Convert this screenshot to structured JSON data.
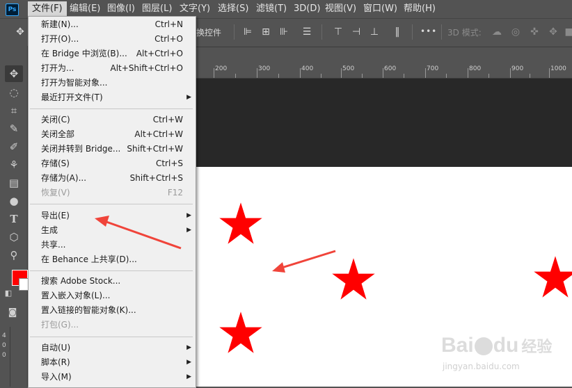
{
  "app": {
    "logo": "Ps"
  },
  "menubar": [
    {
      "label": "文件(F)",
      "active": true
    },
    {
      "label": "编辑(E)"
    },
    {
      "label": "图像(I)"
    },
    {
      "label": "图层(L)"
    },
    {
      "label": "文字(Y)"
    },
    {
      "label": "选择(S)"
    },
    {
      "label": "滤镜(T)"
    },
    {
      "label": "3D(D)"
    },
    {
      "label": "视图(V)"
    },
    {
      "label": "窗口(W)"
    },
    {
      "label": "帮助(H)"
    }
  ],
  "options": {
    "transform_label": "换控件",
    "mode_3d_label": "3D 模式:",
    "more": "•••"
  },
  "ruler": {
    "labels": [
      "200",
      "300",
      "400",
      "500",
      "600",
      "700",
      "800",
      "900",
      "1000"
    ],
    "left_labels": [
      "4",
      "0",
      "0"
    ]
  },
  "colors": {
    "foreground": "#ff0000",
    "background": "#ffffff",
    "star": "#ff0000",
    "arrow": "#f0443a"
  },
  "file_menu": {
    "items": [
      {
        "label": "新建(N)...",
        "shortcut": "Ctrl+N"
      },
      {
        "label": "打开(O)...",
        "shortcut": "Ctrl+O"
      },
      {
        "label": "在 Bridge 中浏览(B)...",
        "shortcut": "Alt+Ctrl+O"
      },
      {
        "label": "打开为...",
        "shortcut": "Alt+Shift+Ctrl+O"
      },
      {
        "label": "打开为智能对象..."
      },
      {
        "label": "最近打开文件(T)",
        "submenu": true
      },
      {
        "label": "关闭(C)",
        "shortcut": "Ctrl+W"
      },
      {
        "label": "关闭全部",
        "shortcut": "Alt+Ctrl+W"
      },
      {
        "label": "关闭并转到 Bridge...",
        "shortcut": "Shift+Ctrl+W"
      },
      {
        "label": "存储(S)",
        "shortcut": "Ctrl+S"
      },
      {
        "label": "存储为(A)...",
        "shortcut": "Shift+Ctrl+S"
      },
      {
        "label": "恢复(V)",
        "shortcut": "F12",
        "disabled": true
      },
      {
        "label": "导出(E)",
        "submenu": true
      },
      {
        "label": "生成",
        "submenu": true
      },
      {
        "label": "共享..."
      },
      {
        "label": "在 Behance 上共享(D)..."
      },
      {
        "label": "搜索 Adobe Stock..."
      },
      {
        "label": "置入嵌入对象(L)..."
      },
      {
        "label": "置入链接的智能对象(K)..."
      },
      {
        "label": "打包(G)...",
        "disabled": true
      },
      {
        "label": "自动(U)",
        "submenu": true
      },
      {
        "label": "脚本(R)",
        "submenu": true
      },
      {
        "label": "导入(M)",
        "submenu": true
      }
    ]
  },
  "watermark": {
    "brand": "Bai",
    "brand2": "du",
    "cn": "经验",
    "url": "jingyan.baidu.com"
  }
}
